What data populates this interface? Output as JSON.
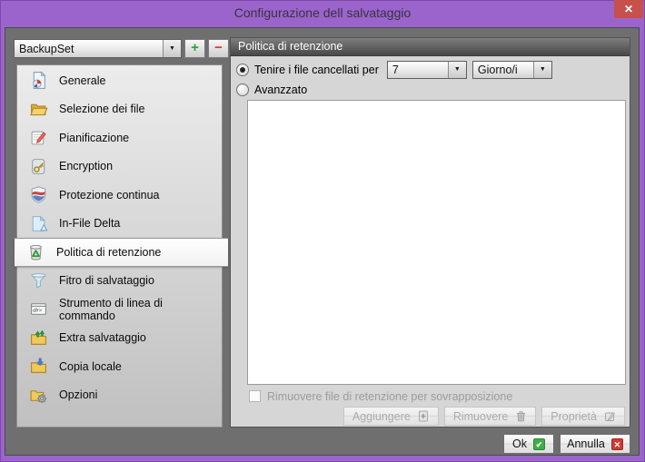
{
  "window": {
    "title": "Configurazione dell salvataggio"
  },
  "icons": {
    "close": "✕",
    "dropdown_arrow": "▼",
    "add_plus": "+",
    "remove_minus": "−",
    "ok_check": "✔",
    "cancel_x": "✕"
  },
  "colors": {
    "titlebar_purple": "#9a64cc",
    "close_red": "#c8504c",
    "body_gray": "#6f6f6f",
    "panel_gray": "#d6d6d6",
    "ok_green": "#3fae49",
    "cancel_red": "#cf3a30"
  },
  "backupset": {
    "value": "BackupSet"
  },
  "sidebar": {
    "items": [
      {
        "label": "Generale",
        "icon": "general-report-icon",
        "selected": false
      },
      {
        "label": "Selezione dei file",
        "icon": "folder-open-icon",
        "selected": false
      },
      {
        "label": "Pianificazione",
        "icon": "schedule-note-pencil-icon",
        "selected": false
      },
      {
        "label": "Encryption",
        "icon": "key-icon",
        "selected": false
      },
      {
        "label": "Protezione continua",
        "icon": "shield-icon",
        "selected": false
      },
      {
        "label": "In-File Delta",
        "icon": "delta-file-icon",
        "selected": false
      },
      {
        "label": "Politica di retenzione",
        "icon": "recycle-bin-icon",
        "selected": true
      },
      {
        "label": "Fitro di salvataggio",
        "icon": "funnel-icon",
        "selected": false
      },
      {
        "label": "Strumento di linea di commando",
        "icon": "command-prompt-icon",
        "selected": false
      },
      {
        "label": "Extra salvataggio",
        "icon": "folder-upload-icon",
        "selected": false
      },
      {
        "label": "Copia locale",
        "icon": "folder-download-icon",
        "selected": false
      },
      {
        "label": "Opzioni",
        "icon": "folder-gear-icon",
        "selected": false
      }
    ]
  },
  "panel": {
    "header": "Politica di retenzione",
    "keep_radio_label": "Tenire i file cancellati per",
    "keep_radio_selected": true,
    "keep_value": "7",
    "keep_unit": "Giorno/i",
    "advanced_radio_label": "Avanzzato",
    "advanced_radio_selected": false,
    "overlap_checkbox_label": "Rimuovere file di retenzione per sovrapposizione",
    "overlap_checkbox_checked": false,
    "add_button": "Aggiungere",
    "remove_button": "Rimuovere",
    "properties_button": "Proprietà"
  },
  "footer": {
    "ok": "Ok",
    "cancel": "Annulla"
  }
}
